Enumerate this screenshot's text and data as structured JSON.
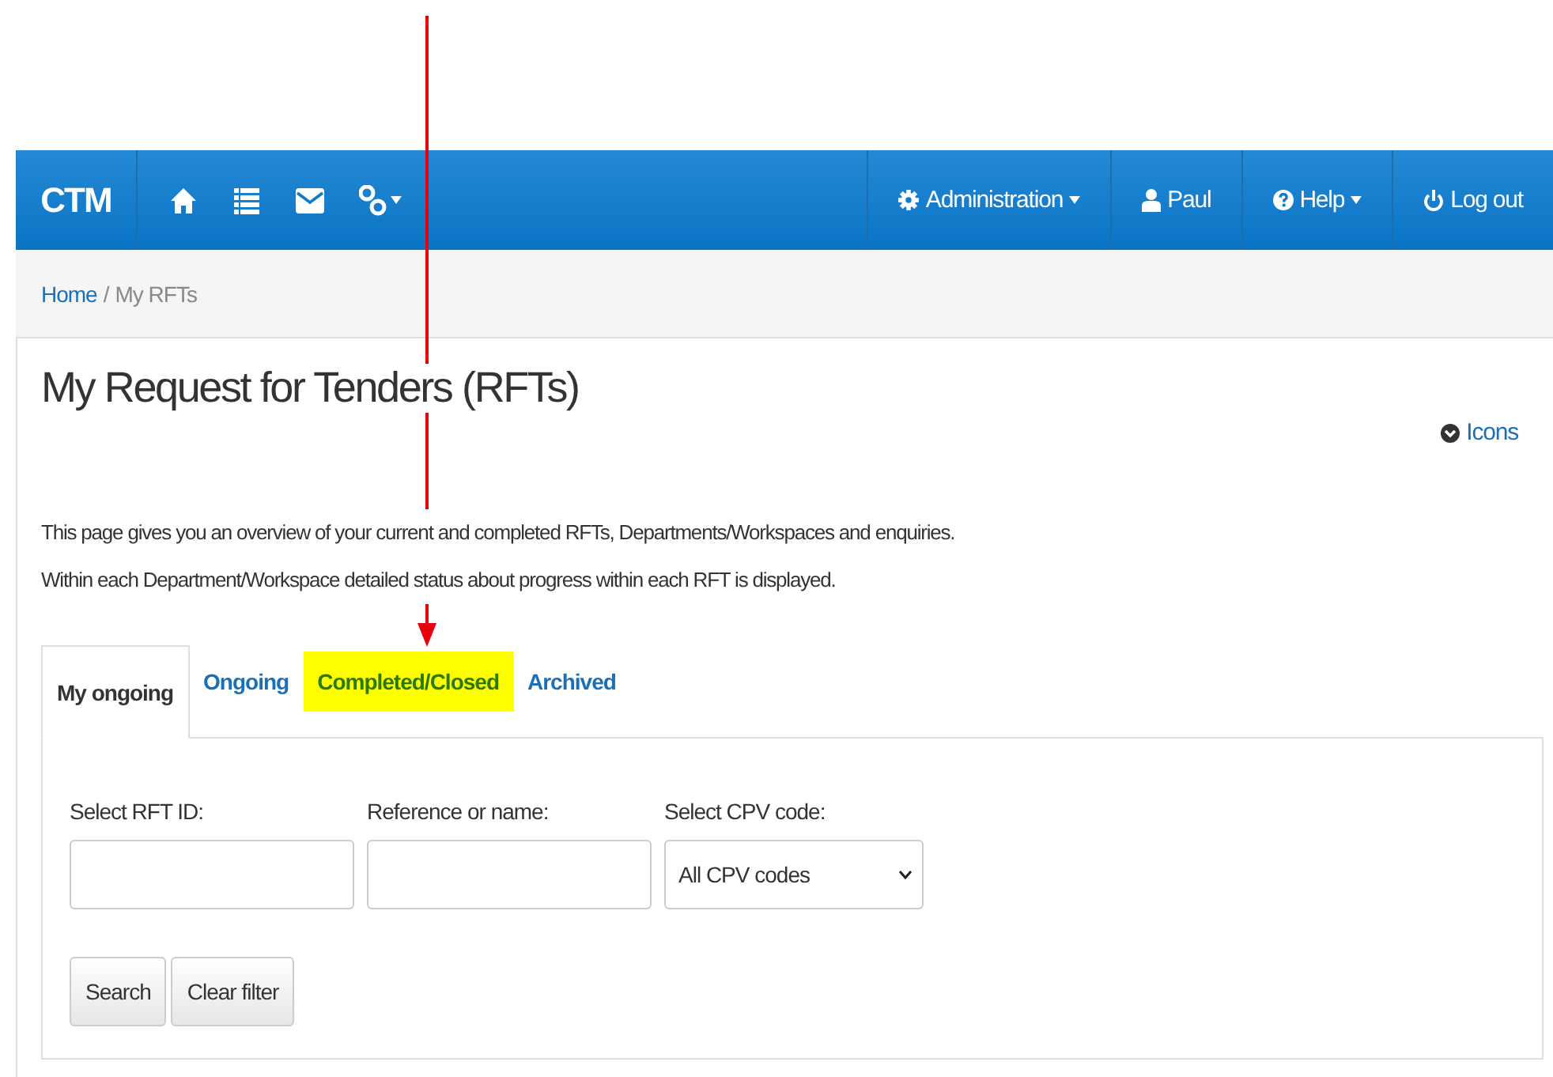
{
  "navbar": {
    "brand": "CTM",
    "icons": [
      {
        "kind": "home",
        "dropdown": false
      },
      {
        "kind": "list",
        "dropdown": false
      },
      {
        "kind": "mail",
        "dropdown": false
      },
      {
        "kind": "link",
        "dropdown": true
      }
    ],
    "right_items": [
      {
        "kind": "gear",
        "label": "Administration",
        "dropdown": true
      },
      {
        "kind": "user",
        "label": "Paul",
        "dropdown": false
      },
      {
        "kind": "help",
        "label": "Help",
        "dropdown": true
      },
      {
        "kind": "power",
        "label": "Log out",
        "dropdown": false
      }
    ]
  },
  "breadcrumb": {
    "link": "Home",
    "separator": "/",
    "current": "My RFTs"
  },
  "page": {
    "title": "My Request for Tenders (RFTs)",
    "icons_link": "Icons",
    "intro": [
      "This page gives you an overview of your current and completed RFTs, Departments/Workspaces and enquiries.",
      "Within each Department/Workspace detailed status about progress within each RFT is displayed."
    ]
  },
  "tabs": [
    {
      "label": "My ongoing",
      "selected": true,
      "highlighted": false
    },
    {
      "label": "Ongoing",
      "selected": false,
      "highlighted": false
    },
    {
      "label": "Completed/Closed",
      "selected": false,
      "highlighted": true
    },
    {
      "label": "Archived",
      "selected": false,
      "highlighted": false
    }
  ],
  "filters": [
    {
      "kind": "text",
      "label": "Select RFT ID:"
    },
    {
      "kind": "text",
      "label": "Reference or name:"
    },
    {
      "kind": "select",
      "label": "Select CPV code:",
      "value": "All CPV codes"
    }
  ],
  "buttons": [
    "Search",
    "Clear filter"
  ],
  "annotations": [
    {
      "kind": "arrow",
      "color": "#e8000b"
    }
  ]
}
